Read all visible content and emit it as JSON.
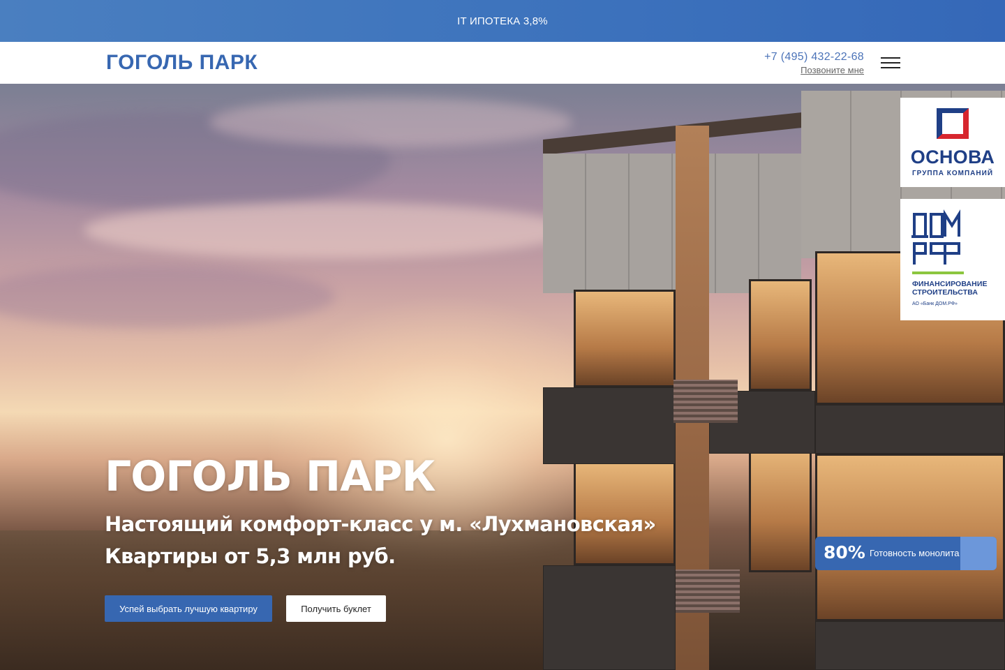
{
  "promo": {
    "text": "IT ИПОТЕКА 3,8%"
  },
  "header": {
    "logo": "ГОГОЛЬ ПАРК",
    "phone": "+7 (495) 432-22-68",
    "callback": "Позвоните мне",
    "menu_icon": "hamburger-menu-icon"
  },
  "hero": {
    "title": "ГОГОЛЬ ПАРК",
    "subtitle_line1": "Настоящий комфорт-класс у м. «Лухмановская»",
    "subtitle_line2": "Квартиры от 5,3 млн руб.",
    "primary_button": "Успей выбрать лучшую квартиру",
    "secondary_button": "Получить буклет"
  },
  "partners": {
    "osnova": {
      "name": "ОСНОВА",
      "subtitle": "ГРУППА КОМПАНИЙ"
    },
    "domrf": {
      "logo_text": "ДОМ.РФ",
      "subtitle_line1": "ФИНАНСИРОВАНИЕ",
      "subtitle_line2": "СТРОИТЕЛЬСТВА",
      "bank": "АО «Банк ДОМ.РФ»"
    }
  },
  "progress": {
    "value": "80%",
    "fraction": 0.8,
    "label": "Готовность монолита"
  },
  "colors": {
    "brand_blue": "#3767b1",
    "progress_light": "#6c97da",
    "domrf_green": "#8cc63f",
    "osnova_red": "#d7262e"
  }
}
